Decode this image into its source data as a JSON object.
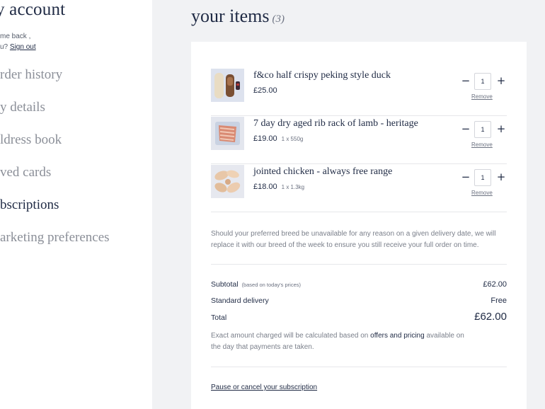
{
  "sidebar": {
    "title": "y account",
    "welcome_line1": "me back ,",
    "welcome_line2_prefix": "u? ",
    "sign_out": "Sign out",
    "items": [
      {
        "label": "rder history"
      },
      {
        "label": "y details"
      },
      {
        "label": "ldress book"
      },
      {
        "label": "ved cards"
      },
      {
        "label": "bscriptions"
      },
      {
        "label": "arketing preferences"
      }
    ]
  },
  "main": {
    "title": "your items",
    "count": "(3)"
  },
  "cart": {
    "items": [
      {
        "name": "f&co half crispy peking style duck",
        "price": "£25.00",
        "weight": "",
        "qty": "1",
        "remove": "Remove"
      },
      {
        "name": "7 day dry aged rib rack of lamb - heritage",
        "price": "£19.00",
        "weight": "1 x 550g",
        "qty": "1",
        "remove": "Remove"
      },
      {
        "name": "jointed chicken - always free range",
        "price": "£18.00",
        "weight": "1 x 1.3kg",
        "qty": "1",
        "remove": "Remove"
      }
    ],
    "note": "Should your preferred breed be unavailable for any reason on a given delivery date, we will replace it with our breed of the week to ensure you still receive your full order on time.",
    "subtotal_label": "Subtotal",
    "subtotal_note": "(based on today's prices)",
    "subtotal_value": "£62.00",
    "delivery_label": "Standard delivery",
    "delivery_value": "Free",
    "total_label": "Total",
    "total_value": "£62.00",
    "exact_prefix": "Exact amount charged will be calculated based on ",
    "exact_link": "offers and pricing",
    "exact_suffix": " available on the day that payments are taken.",
    "pause_link": "Pause or cancel your subscription"
  },
  "colors": {
    "brand_navy": "#1f2a44",
    "muted_grey": "#8b8f98",
    "page_bg": "#f1f2f4"
  }
}
